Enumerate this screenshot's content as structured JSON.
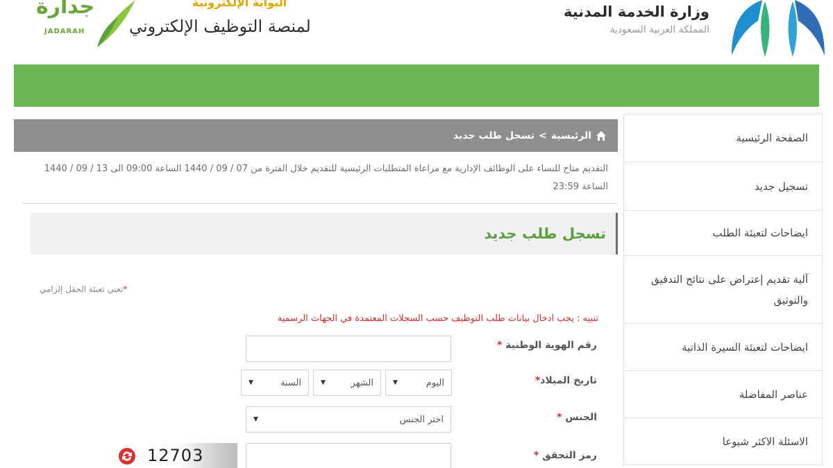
{
  "header": {
    "ministry_title": "وزارة الخدمة المدنية",
    "ministry_subtitle": "المملكة العربية السعودية",
    "portal_title": "البوابة الإلكترونية",
    "platform_title": "لمنصة التوظيف الإلكتروني",
    "brand_arabic": "جدارة",
    "brand_latin": "JADARAH"
  },
  "colors": {
    "green_bar": "#6db656",
    "breadcrumb_bg": "#8e8e8e",
    "accent_green": "#5aa03f",
    "required_red": "#d32f2f",
    "portal_gold": "#e0a700"
  },
  "sidebar": {
    "items": [
      {
        "label": "الصفحة الرئيسية"
      },
      {
        "label": "تسجيل جديد"
      },
      {
        "label": "ايضاحات لتعبئة الطلب"
      },
      {
        "label": "آلية تقديم إعتراض على نتائج التدقيق والتوثيق"
      },
      {
        "label": "ايضاحات لتعبئة السيرة الذاتية"
      },
      {
        "label": "عناصر المفاضلة"
      },
      {
        "label": "الاسئلة الاكثر شيوعا"
      }
    ]
  },
  "breadcrumb": {
    "home": "الرئيسية",
    "separator": ">",
    "current": "تسجل طلب جديد"
  },
  "notice": "التقديم متاح للنساء على الوظائف الإدارية مع مراعاة المتطلبات الرئيسية للتقديم خلال الفترة من 07 / 09 / 1440 الساعة 09:00 الى 13 / 09 / 1440 الساعة 23:59",
  "form": {
    "title": "تسجل طلب جديد",
    "required_note": "تعني تعبئة الحقل إلزامي",
    "warning": "تنبيه : يجب ادخال بيانات طلب التوظيف حسب السجلات المعتمدة في الجهات الرسمية",
    "national_id": {
      "label": "رقم الهوية الوطنية",
      "value": ""
    },
    "birth_date": {
      "label": "تاريخ الميلاد",
      "day": "اليوم",
      "month": "الشهر",
      "year": "السنة"
    },
    "gender": {
      "label": "الجنس",
      "value": "اختر الجنس"
    },
    "captcha": {
      "label": "رمز التحقق",
      "code": "12703",
      "value": ""
    }
  }
}
